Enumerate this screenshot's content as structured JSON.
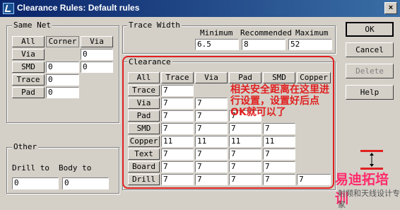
{
  "window": {
    "title": "Clearance Rules: Default rules",
    "close_label": "×"
  },
  "same_net": {
    "legend": "Same Net",
    "col_all": "All",
    "col_corner": "Corner",
    "col_via": "Via",
    "rows": [
      {
        "label": "Via",
        "corner": "",
        "via": "0"
      },
      {
        "label": "SMD",
        "corner": "0",
        "via": "0"
      },
      {
        "label": "Trace",
        "corner": "0"
      },
      {
        "label": "Pad",
        "corner": "0"
      }
    ]
  },
  "trace_width": {
    "legend": "Trace Width",
    "min_label": "Minimum",
    "rec_label": "Recommended",
    "max_label": "Maximum",
    "min_value": "6.5",
    "rec_value": "8",
    "max_value": "52"
  },
  "clearance": {
    "legend": "Clearance",
    "all_label": "All",
    "columns": [
      "Trace",
      "Via",
      "Pad",
      "SMD",
      "Copper"
    ],
    "rows": [
      {
        "label": "Trace",
        "values": [
          "7"
        ]
      },
      {
        "label": "Via",
        "values": [
          "7",
          "7"
        ]
      },
      {
        "label": "Pad",
        "values": [
          "7",
          "7",
          "7"
        ]
      },
      {
        "label": "SMD",
        "values": [
          "7",
          "7",
          "7",
          "7"
        ]
      },
      {
        "label": "Copper",
        "values": [
          "11",
          "11",
          "11",
          "11"
        ]
      },
      {
        "label": "Text",
        "values": [
          "7",
          "7",
          "7",
          "7"
        ]
      },
      {
        "label": "Board",
        "values": [
          "7",
          "7",
          "7",
          "7"
        ]
      },
      {
        "label": "Drill",
        "values": [
          "7",
          "7",
          "7",
          "7",
          "7"
        ]
      }
    ]
  },
  "other": {
    "legend": "Other",
    "drill_to_label": "Drill to",
    "body_to_label": "Body to",
    "drill_to_value": "0",
    "body_to_value": "0"
  },
  "buttons": {
    "ok": "OK",
    "cancel": "Cancel",
    "delete": "Delete",
    "help": "Help"
  },
  "annotation": {
    "text": "相关安全距离在这里进行设置，设置好后点OK就可以了",
    "color": "#e02020"
  },
  "watermark": {
    "line1": "易迪拓培训",
    "line2": "射频和天线设计专家"
  },
  "colors": {
    "titlebar": "#0a246a",
    "dialog": "#d4d0c8",
    "annotation": "#e02020"
  }
}
